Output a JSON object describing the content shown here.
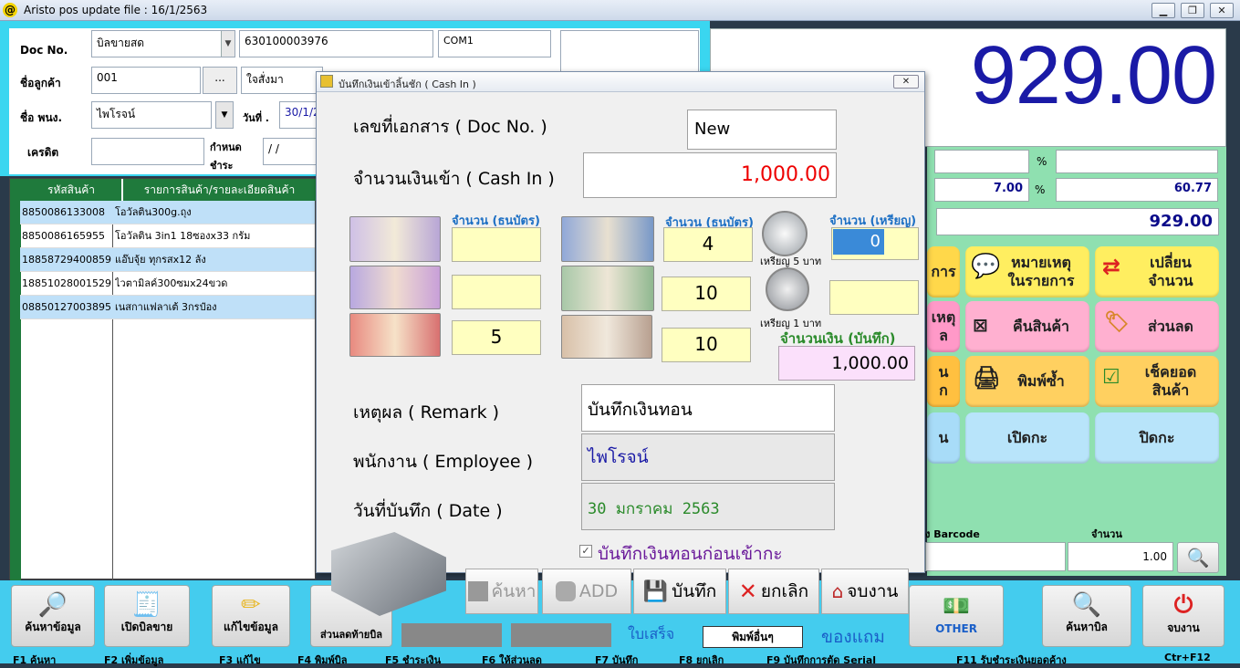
{
  "window": {
    "title": "Aristo pos  update file : 16/1/2563",
    "min": "▁",
    "max": "❐",
    "close": "✕"
  },
  "form": {
    "doc_label": "Doc No.",
    "doc_type": "บิลขายสด",
    "doc_no": "630100003976",
    "port": "COM1",
    "customer_label": "ชื่อลูกค้า",
    "customer_code": "001",
    "browse": "...",
    "customer_name": "ใจสั่งมา",
    "employee_label": "ชื่อ พนง.",
    "employee": "ไพโรจน์",
    "date_label": "วันที่ .",
    "date": "30/1/2",
    "credit_label": "เครดิต",
    "due_label_1": "กำหนด",
    "due_label_2": "ชำระ",
    "due_value": "/ /"
  },
  "total": {
    "amount": "929.00"
  },
  "summary": {
    "pct": "%",
    "pct2": "%",
    "vat_rate": "7.00",
    "vat_amount": "60.77",
    "net": "929.00"
  },
  "right_buttons": [
    {
      "l1": "การ",
      "l2": ""
    },
    {
      "l1": "หมายเหตุ",
      "l2": "ในรายการ"
    },
    {
      "l1": "เปลี่ยน",
      "l2": "จำนวน"
    },
    {
      "l1": "เหตุ",
      "l2": "ล"
    },
    {
      "l1": "คืนสินค้า",
      "l2": ""
    },
    {
      "l1": "ส่วนลด",
      "l2": ""
    },
    {
      "l1": "น",
      "l2": "ก"
    },
    {
      "l1": "พิมพ์ซ้ำ",
      "l2": ""
    },
    {
      "l1": "เช็คยอด",
      "l2": "สินค้า"
    },
    {
      "l1": "น",
      "l2": ""
    },
    {
      "l1": "เปิดกะ",
      "l2": ""
    },
    {
      "l1": "ปิดกะ",
      "l2": ""
    }
  ],
  "barcode": {
    "label": "ง Barcode",
    "qty_label": "จำนวน",
    "qty": "1.00"
  },
  "grid": {
    "col1": "รหัสสินค้า",
    "col2": "รายการสินค้า/รายละเอียดสินค้า",
    "rows": [
      {
        "code": "8850086133008",
        "name": "โอวัลติน300g.ถุง"
      },
      {
        "code": "8850086165955",
        "name": "โอวัลติน 3in1 18ซองx33 กรัม"
      },
      {
        "code": "18858729400859",
        "name": "แอ๊บจุ้ย ทุกรสx12 ลัง"
      },
      {
        "code": "18851028001529",
        "name": "ไวตามิลค์300ซมx24ขวด"
      },
      {
        "code": "08850127003895",
        "name": "เนสกาแฟลาเต้ 3กรป๋อง"
      }
    ]
  },
  "bottom": {
    "b1": "ค้นหาข้อมูล",
    "b2": "เปิดบิลขาย",
    "b3": "แก้ไขข้อมูล",
    "b4": "ส่วนลดท้ายบิล",
    "b5": "ใบเสร็จ",
    "b6": "พิมพ์อื่นๆ",
    "b7": "ของแถม",
    "b8": "OTHER",
    "b9": "ค้นหาบิล",
    "b10": "จบงาน",
    "fkeys": [
      "F1 ค้นหา",
      "F2 เพิ่มข้อมูล",
      "F3 แก้ไข",
      "F4 พิมพ์บิล",
      "F5 ชำระเงิน",
      "F6 ให้ส่วนลด",
      "F7 บันทึก",
      "F8 ยกเลิก",
      "F9 บันทึกการตัด Serial",
      "F11 รับชำระเงินยอดค้าง",
      "Ctr+F12"
    ]
  },
  "dialog": {
    "title": "บันทึกเงินเข้าลิ้นชัก ( Cash In )",
    "doc_label": "เลขที่เอกสาร ( Doc No. )",
    "doc_value": "New",
    "cash_label": "จำนวนเงินเข้า ( Cash In )",
    "cash_value": "1,000.00",
    "qty_bank_1": "จำนวน (ธนบัตร)",
    "qty_bank_2": "จำนวน (ธนบัตร)",
    "qty_coin": "จำนวน (เหรียญ)",
    "notes": [
      {
        "denom": "1000",
        "qty": ""
      },
      {
        "denom": "500",
        "qty": ""
      },
      {
        "denom": "100",
        "qty": "5"
      },
      {
        "denom": "50",
        "qty": "4"
      },
      {
        "denom": "20",
        "qty": "10"
      },
      {
        "denom": "10",
        "qty": "10"
      }
    ],
    "coin5_label": "เหรียญ 5 บาท",
    "coin5_qty": "0",
    "coin1_label": "เหรียญ 1 บาท",
    "coin1_qty": "",
    "saved_label": "จำนวนเงิน (บันทึก)",
    "saved_value": "1,000.00",
    "remark_label": "เหตุผล ( Remark )",
    "remark_value": "บันทึกเงินทอน",
    "employee_label": "พนักงาน ( Employee )",
    "employee_value": "ไพโรจน์",
    "date_label": "วันที่บันทึก ( Date )",
    "date_value": "30 มกราคม 2563",
    "checkbox_label": "บันทึกเงินทอนก่อนเข้ากะ",
    "btn_search": "ค้นหา",
    "btn_add": "ADD",
    "btn_save": "บันทึก",
    "btn_cancel": "ยกเลิก",
    "btn_close": "จบงาน"
  }
}
